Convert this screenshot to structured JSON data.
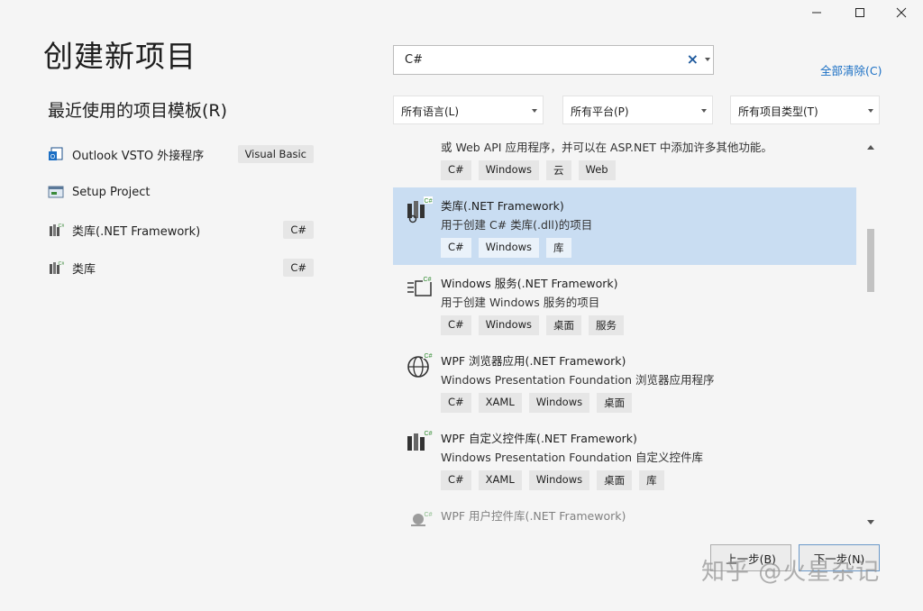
{
  "window": {
    "controls": [
      "minimize-icon",
      "maximize-icon",
      "close-icon"
    ]
  },
  "header": {
    "title": "创建新项目"
  },
  "recent": {
    "heading": "最近使用的项目模板(R)",
    "items": [
      {
        "label": "Outlook VSTO 外接程序",
        "badge": "Visual Basic",
        "icon": "outlook-vsto-icon"
      },
      {
        "label": "Setup Project",
        "badge": "",
        "icon": "setup-project-icon"
      },
      {
        "label": "类库(.NET Framework)",
        "badge": "C#",
        "icon": "class-library-icon"
      },
      {
        "label": "类库",
        "badge": "C#",
        "icon": "class-library-icon"
      }
    ]
  },
  "search": {
    "value": "C#",
    "clear_glyph": "×"
  },
  "clear_all": "全部清除(C)",
  "filters": {
    "language": "所有语言(L)",
    "platform": "所有平台(P)",
    "project_type": "所有项目类型(T)"
  },
  "templates": [
    {
      "name": "",
      "desc": "或 Web API 应用程序，并可以在 ASP.NET 中添加许多其他功能。",
      "tags": [
        "C#",
        "Windows",
        "云",
        "Web"
      ],
      "icon": "",
      "partial": true
    },
    {
      "name": "类库(.NET Framework)",
      "desc": "用于创建 C# 类库(.dll)的项目",
      "tags": [
        "C#",
        "Windows",
        "库"
      ],
      "icon": "class-library-icon",
      "selected": true
    },
    {
      "name": "Windows 服务(.NET Framework)",
      "desc": "用于创建 Windows 服务的项目",
      "tags": [
        "C#",
        "Windows",
        "桌面",
        "服务"
      ],
      "icon": "windows-service-icon"
    },
    {
      "name": "WPF 浏览器应用(.NET Framework)",
      "desc": "Windows Presentation Foundation 浏览器应用程序",
      "tags": [
        "C#",
        "XAML",
        "Windows",
        "桌面"
      ],
      "icon": "wpf-browser-icon"
    },
    {
      "name": "WPF 自定义控件库(.NET Framework)",
      "desc": "Windows Presentation Foundation 自定义控件库",
      "tags": [
        "C#",
        "XAML",
        "Windows",
        "桌面",
        "库"
      ],
      "icon": "wpf-control-library-icon"
    },
    {
      "name": "WPF 用户控件库(.NET Framework)",
      "desc": "",
      "tags": [],
      "icon": "wpf-user-control-icon",
      "partial": true
    }
  ],
  "buttons": {
    "back": "上一步(B)",
    "next": "下一步(N)"
  },
  "watermark": "知乎 @火星杂记",
  "colors": {
    "selection": "#c9ddf2",
    "link": "#1a6fc4",
    "accent": "#1f5a9d"
  }
}
